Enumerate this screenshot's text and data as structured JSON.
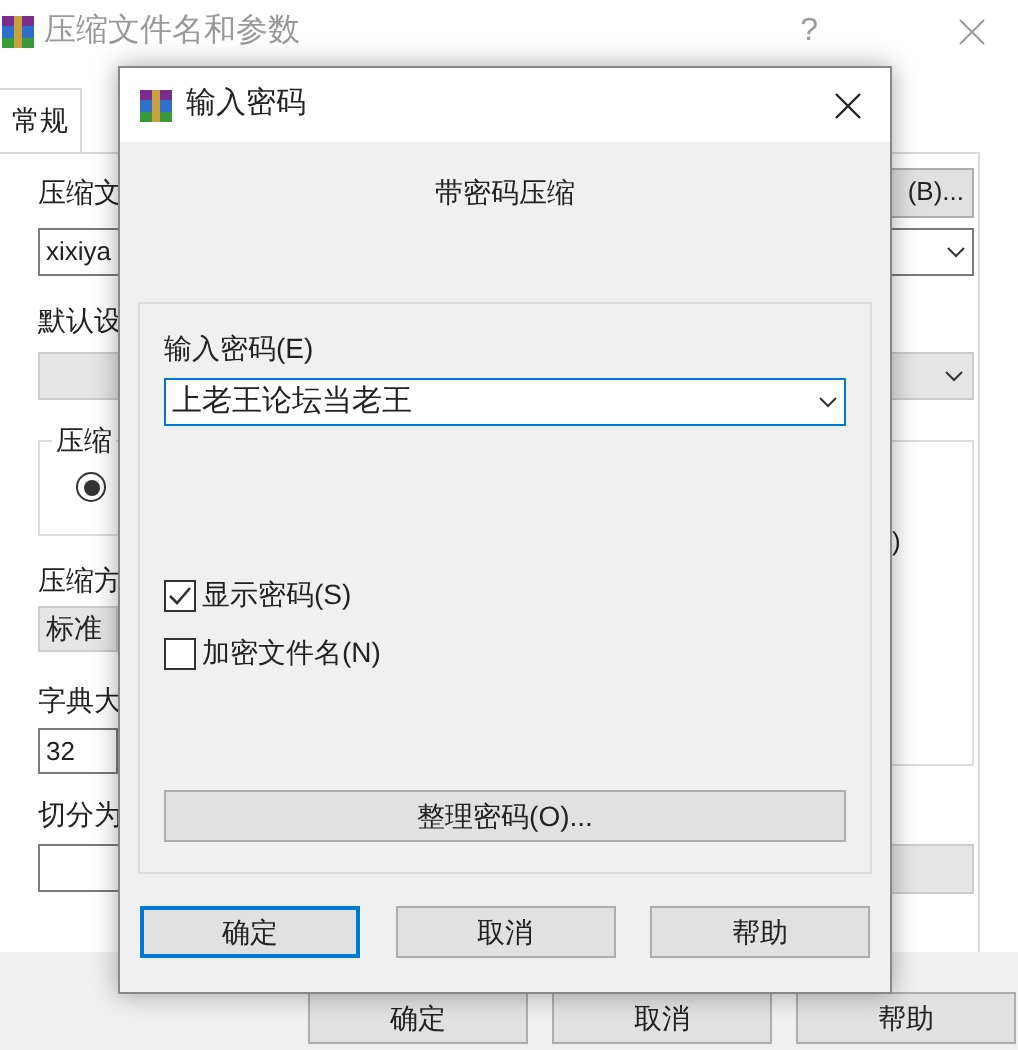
{
  "window": {
    "title": "压缩文件名和参数",
    "help": "?"
  },
  "tabs": [
    {
      "label": "常规",
      "selected": true
    }
  ],
  "background": {
    "archive_label": "压缩文",
    "browse_button": "(B)...",
    "archive_value": "xixiya",
    "profile_label": "默认设",
    "group_label": "压缩",
    "radio_selected": true,
    "radio_fragment": ")",
    "method_label": "压缩方",
    "method_value": "标准",
    "dict_label": "字典大",
    "dict_value": "32",
    "split_label": "切分为"
  },
  "buttons": [
    "确定",
    "取消",
    "帮助"
  ],
  "dialog": {
    "title": "输入密码",
    "heading": "带密码压缩",
    "password_label": "输入密码(E)",
    "password_value": "上老王论坛当老王",
    "options": [
      {
        "label": "显示密码(S)",
        "checked": true
      },
      {
        "label": "加密文件名(N)",
        "checked": false
      }
    ],
    "organize_button": "整理密码(O)...",
    "buttons": [
      {
        "label": "确定",
        "selected": true
      },
      {
        "label": "取消",
        "selected": false
      },
      {
        "label": "帮助",
        "selected": false
      }
    ]
  }
}
